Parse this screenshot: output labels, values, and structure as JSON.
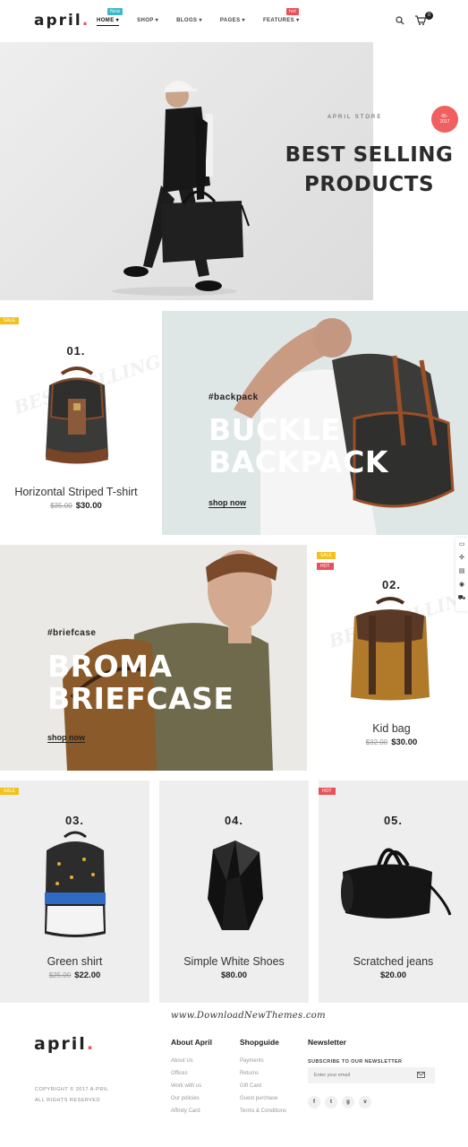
{
  "header": {
    "logo": "april",
    "logo_dot": ".",
    "nav": [
      {
        "label": "HOME ▾",
        "badge": "New"
      },
      {
        "label": "SHOP ▾"
      },
      {
        "label": "BLOGS ▾"
      },
      {
        "label": "PAGES ▾"
      },
      {
        "label": "FEATURES ▾",
        "badge": "hot"
      }
    ],
    "cart_count": "0"
  },
  "hero": {
    "tag": "APRIL STORE",
    "date_line1": "05-",
    "date_line2": "2017",
    "title_line1": "BEST SELLING",
    "title_line2": "PRODUCTS"
  },
  "products": [
    {
      "num": "01.",
      "name": "Horizontal Striped T-shirt",
      "old_price": "$35.00",
      "price": "$30.00",
      "badges": [
        "SALE"
      ]
    },
    {
      "num": "02.",
      "name": "Kid bag",
      "old_price": "$32.00",
      "price": "$30.00",
      "badges": [
        "SALE",
        "HOT"
      ]
    },
    {
      "num": "03.",
      "name": "Green shirt",
      "old_price": "$25.00",
      "price": "$22.00",
      "badges": [
        "SALE"
      ]
    },
    {
      "num": "04.",
      "name": "Simple White Shoes",
      "old_price": "",
      "price": "$80.00",
      "badges": []
    },
    {
      "num": "05.",
      "name": "Scratched jeans",
      "old_price": "",
      "price": "$20.00",
      "badges": [
        "HOT"
      ]
    }
  ],
  "watermark_text": "BEST SELLING",
  "promo_backpack": {
    "tag": "#backpack",
    "title_line1": "BUCKLE",
    "title_line2": "BACKPACK",
    "link": "shop now"
  },
  "promo_briefcase": {
    "tag": "#briefcase",
    "title_line1": "BROMA",
    "title_line2": "BRIEFCASE",
    "link": "shop now"
  },
  "footer": {
    "watermark": "www.DownloadNewThemes.com",
    "logo": "april",
    "logo_dot": ".",
    "copyright_line1": "COPYRIGHT © 2017 A-PRIL",
    "copyright_line2": "ALL RIGHTS RESERVED",
    "about": {
      "title": "About April",
      "links": [
        "About Us",
        "Offices",
        "Work with us",
        "Our policies",
        "Affinity Card"
      ]
    },
    "shopguide": {
      "title": "Shopguide",
      "links": [
        "Payments",
        "Returns",
        "Gift Card",
        "Guest purchase",
        "Terms & Conditions"
      ]
    },
    "newsletter": {
      "title": "Newsletter",
      "label": "SUBSCRIBE TO OUR NEWSLETTER",
      "placeholder": "Enter your email"
    },
    "socials": [
      "f",
      "t",
      "g",
      "v"
    ]
  },
  "colors": {
    "accent": "#e8505b",
    "sale": "#f3c11d",
    "new": "#3fb8c6",
    "card_gray": "#eeeeee",
    "backpack_bg": "#dfe6e6",
    "briefcase_bg": "#ebe9e6"
  }
}
